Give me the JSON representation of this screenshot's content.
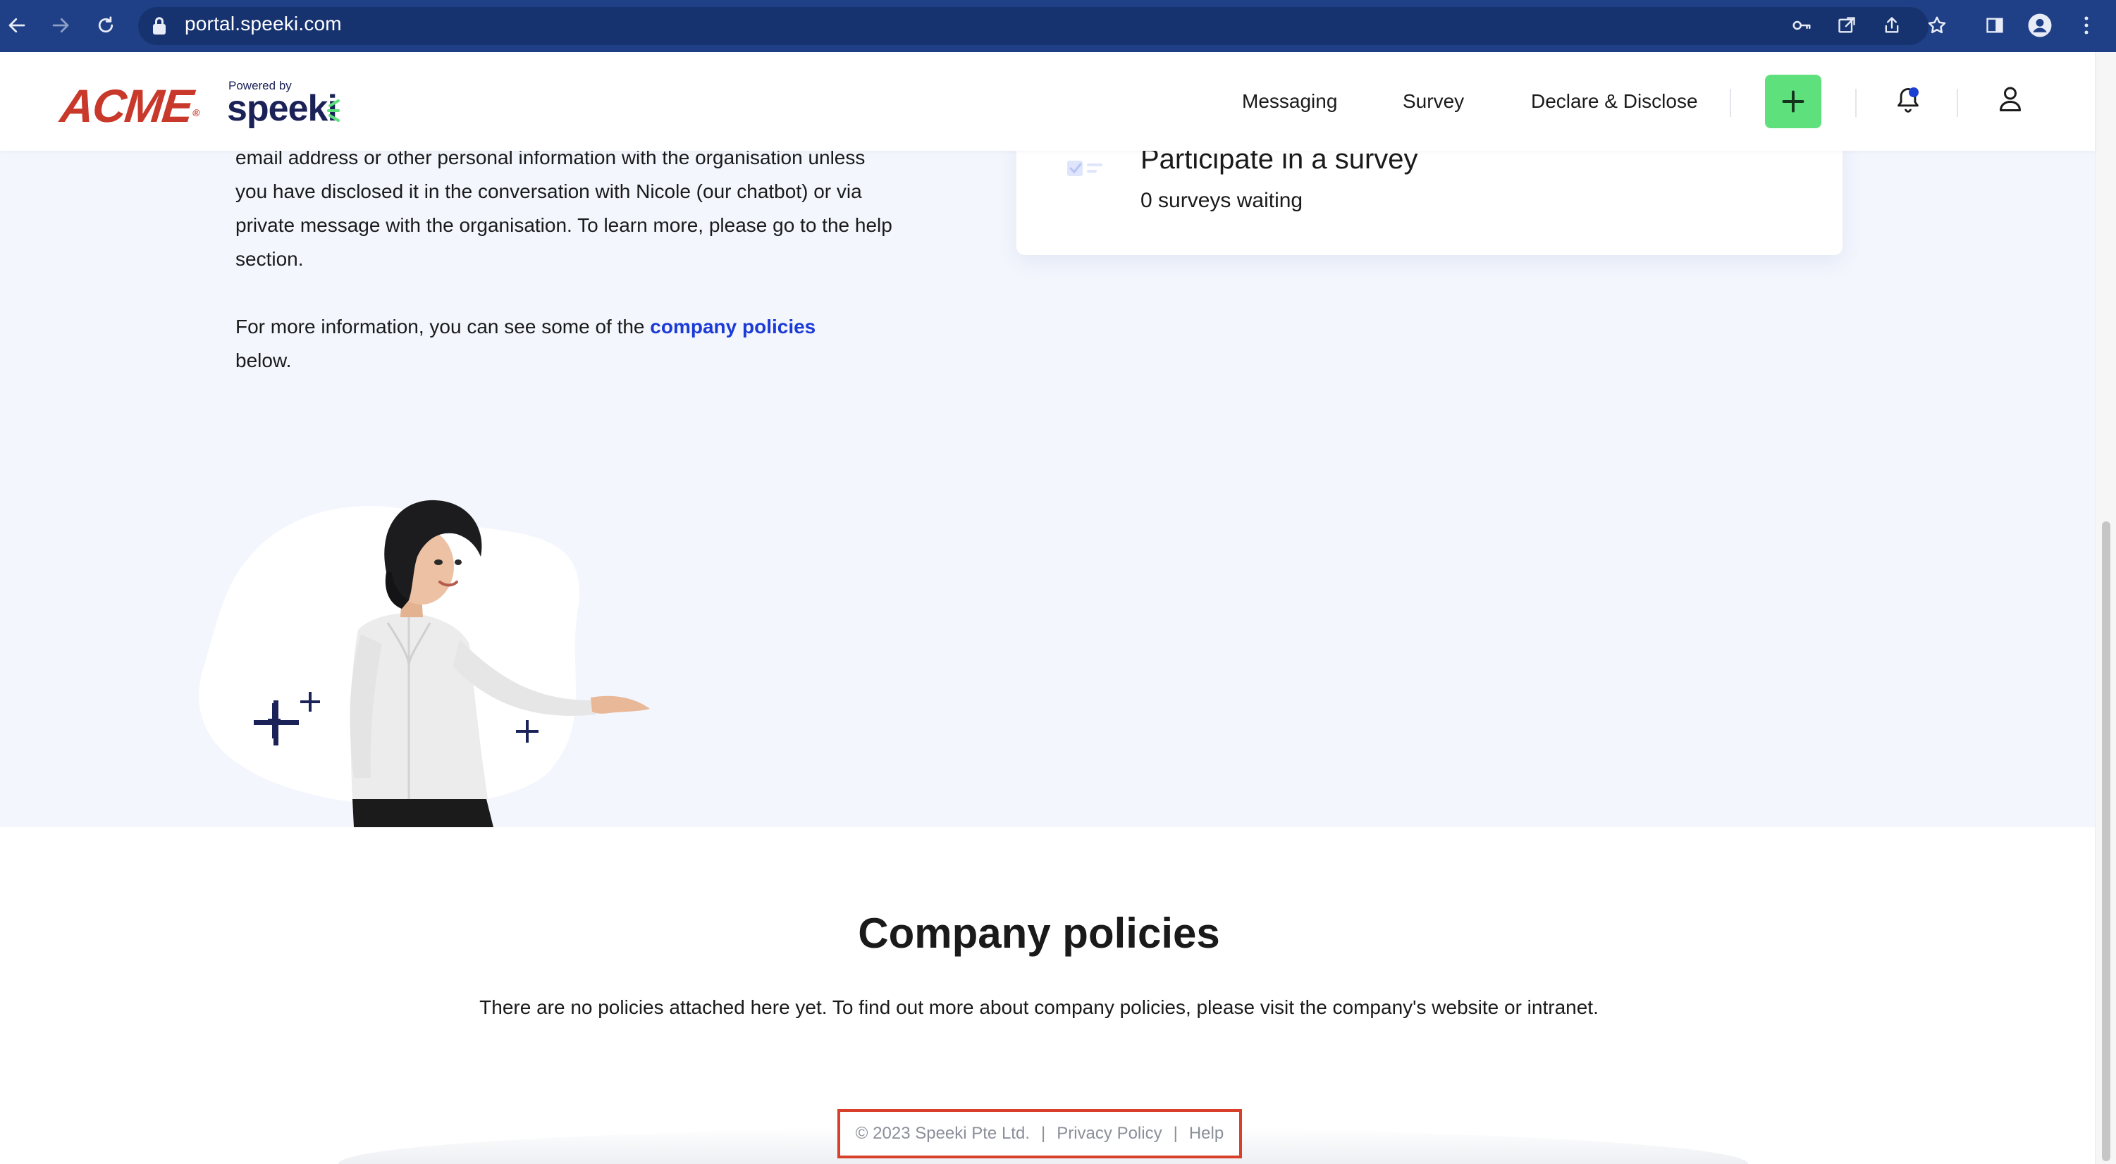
{
  "browser": {
    "url": "portal.speeki.com"
  },
  "header": {
    "brand": "ACME",
    "brand_mark": "®",
    "powered_by": "Powered by",
    "speeki": "speeki",
    "nav": [
      {
        "label": "Messaging"
      },
      {
        "label": "Survey"
      },
      {
        "label": "Declare & Disclose"
      }
    ],
    "accent_color": "#5ee17d"
  },
  "hero": {
    "paragraph1_lines": [
      "email address or other personal information with the organisation unless",
      "you have disclosed it in the conversation with Nicole (our chatbot) or via",
      "private message with the organisation. To learn more, please go to the help",
      "section."
    ],
    "paragraph2_prefix": "For more information, you can see some of the",
    "paragraph2_link": "company policies",
    "paragraph2_suffix": "below.",
    "survey_title": "Participate in a survey",
    "survey_count": "0 surveys waiting"
  },
  "policies": {
    "title": "Company policies",
    "text": "There are no policies attached here yet. To find out more about company policies, please visit the company's website or intranet."
  },
  "footer": {
    "copyright": "© 2023 Speeki Pte Ltd.",
    "privacy": "Privacy Policy",
    "help": "Help",
    "separator": "|"
  }
}
